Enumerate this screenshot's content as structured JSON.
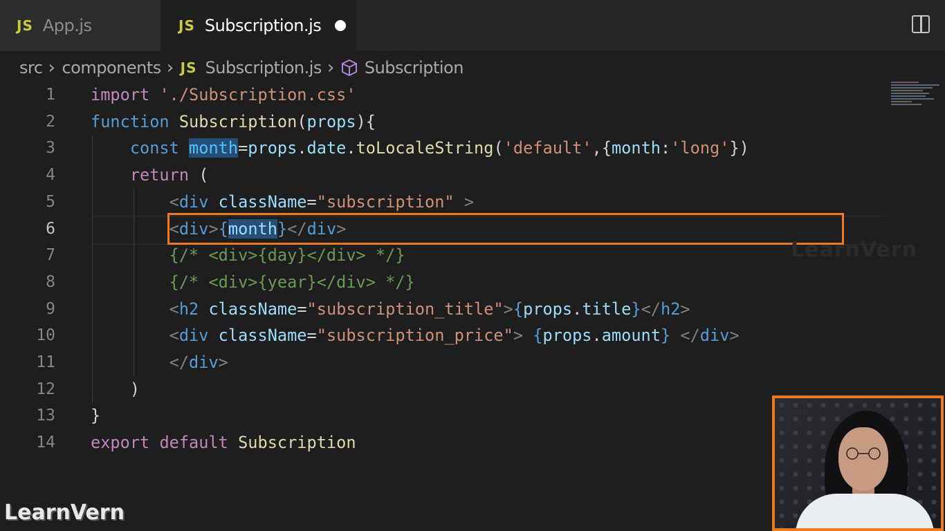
{
  "tabs": [
    {
      "icon": "JS",
      "label": "App.js",
      "active": false
    },
    {
      "icon": "JS",
      "label": "Subscription.js",
      "active": true,
      "dirty": true
    }
  ],
  "breadcrumb": {
    "parts": [
      "src",
      "components"
    ],
    "file_icon": "JS",
    "file": "Subscription.js",
    "symbol": "Subscription"
  },
  "editor": {
    "active_line": 6,
    "line_numbers": [
      "1",
      "2",
      "3",
      "4",
      "5",
      "6",
      "7",
      "8",
      "9",
      "10",
      "11",
      "12",
      "13",
      "14"
    ],
    "lines": [
      [
        {
          "t": "import ",
          "c": "#c586c0"
        },
        {
          "t": "'./Subscription.css'",
          "c": "#ce9178"
        }
      ],
      [
        {
          "t": "function ",
          "c": "#569cd6"
        },
        {
          "t": "Subscription",
          "c": "#dcdcaa"
        },
        {
          "t": "(",
          "c": "#d4d4d4"
        },
        {
          "t": "props",
          "c": "#9cdcfe"
        },
        {
          "t": "){",
          "c": "#d4d4d4"
        }
      ],
      [
        {
          "t": "    const ",
          "c": "#569cd6"
        },
        {
          "t": "month",
          "c": "#4fc1ff",
          "sel": true
        },
        {
          "t": "=",
          "c": "#d4d4d4"
        },
        {
          "t": "props",
          "c": "#9cdcfe"
        },
        {
          "t": ".",
          "c": "#d4d4d4"
        },
        {
          "t": "date",
          "c": "#9cdcfe"
        },
        {
          "t": ".",
          "c": "#d4d4d4"
        },
        {
          "t": "toLocaleString",
          "c": "#dcdcaa"
        },
        {
          "t": "(",
          "c": "#d4d4d4"
        },
        {
          "t": "'default'",
          "c": "#ce9178"
        },
        {
          "t": ",{",
          "c": "#d4d4d4"
        },
        {
          "t": "month",
          "c": "#9cdcfe"
        },
        {
          "t": ":",
          "c": "#d4d4d4"
        },
        {
          "t": "'long'",
          "c": "#ce9178"
        },
        {
          "t": "})",
          "c": "#d4d4d4"
        }
      ],
      [
        {
          "t": "    return ",
          "c": "#c586c0"
        },
        {
          "t": "(",
          "c": "#d4d4d4"
        }
      ],
      [
        {
          "t": "        <",
          "c": "#808080"
        },
        {
          "t": "div ",
          "c": "#569cd6"
        },
        {
          "t": "className",
          "c": "#9cdcfe"
        },
        {
          "t": "=",
          "c": "#d4d4d4"
        },
        {
          "t": "\"subscription\"",
          "c": "#ce9178"
        },
        {
          "t": " >",
          "c": "#808080"
        }
      ],
      [
        {
          "t": "        <",
          "c": "#808080"
        },
        {
          "t": "div",
          "c": "#569cd6"
        },
        {
          "t": ">",
          "c": "#808080"
        },
        {
          "t": "{",
          "c": "#569cd6"
        },
        {
          "t": "month",
          "c": "#9cdcfe",
          "sel": true
        },
        {
          "t": "}",
          "c": "#569cd6"
        },
        {
          "t": "</",
          "c": "#808080"
        },
        {
          "t": "div",
          "c": "#569cd6"
        },
        {
          "t": ">",
          "c": "#808080"
        }
      ],
      [
        {
          "t": "        {/* <div>{day}</div> */}",
          "c": "#6a9955"
        }
      ],
      [
        {
          "t": "        {/* <div>{year}</div> */}",
          "c": "#6a9955"
        }
      ],
      [
        {
          "t": "        <",
          "c": "#808080"
        },
        {
          "t": "h2 ",
          "c": "#569cd6"
        },
        {
          "t": "className",
          "c": "#9cdcfe"
        },
        {
          "t": "=",
          "c": "#d4d4d4"
        },
        {
          "t": "\"subscription_title\"",
          "c": "#ce9178"
        },
        {
          "t": ">",
          "c": "#808080"
        },
        {
          "t": "{",
          "c": "#569cd6"
        },
        {
          "t": "props",
          "c": "#9cdcfe"
        },
        {
          "t": ".",
          "c": "#d4d4d4"
        },
        {
          "t": "title",
          "c": "#9cdcfe"
        },
        {
          "t": "}",
          "c": "#569cd6"
        },
        {
          "t": "</",
          "c": "#808080"
        },
        {
          "t": "h2",
          "c": "#569cd6"
        },
        {
          "t": ">",
          "c": "#808080"
        }
      ],
      [
        {
          "t": "        <",
          "c": "#808080"
        },
        {
          "t": "div ",
          "c": "#569cd6"
        },
        {
          "t": "className",
          "c": "#9cdcfe"
        },
        {
          "t": "=",
          "c": "#d4d4d4"
        },
        {
          "t": "\"subscription_price\"",
          "c": "#ce9178"
        },
        {
          "t": "> ",
          "c": "#808080"
        },
        {
          "t": "{",
          "c": "#569cd6"
        },
        {
          "t": "props",
          "c": "#9cdcfe"
        },
        {
          "t": ".",
          "c": "#d4d4d4"
        },
        {
          "t": "amount",
          "c": "#9cdcfe"
        },
        {
          "t": "}",
          "c": "#569cd6"
        },
        {
          "t": " </",
          "c": "#808080"
        },
        {
          "t": "div",
          "c": "#569cd6"
        },
        {
          "t": ">",
          "c": "#808080"
        }
      ],
      [
        {
          "t": "        </",
          "c": "#808080"
        },
        {
          "t": "div",
          "c": "#569cd6"
        },
        {
          "t": ">",
          "c": "#808080"
        }
      ],
      [
        {
          "t": "    )",
          "c": "#d4d4d4"
        }
      ],
      [
        {
          "t": "}",
          "c": "#d4d4d4"
        }
      ],
      [
        {
          "t": "export ",
          "c": "#c586c0"
        },
        {
          "t": "default ",
          "c": "#c586c0"
        },
        {
          "t": "Subscription",
          "c": "#dcdcaa"
        }
      ]
    ]
  },
  "watermark": "LearnVern",
  "colors": {
    "accent": "#f0791f",
    "js_icon": "#cbcb41",
    "editor_bg": "#1e1e1e"
  }
}
